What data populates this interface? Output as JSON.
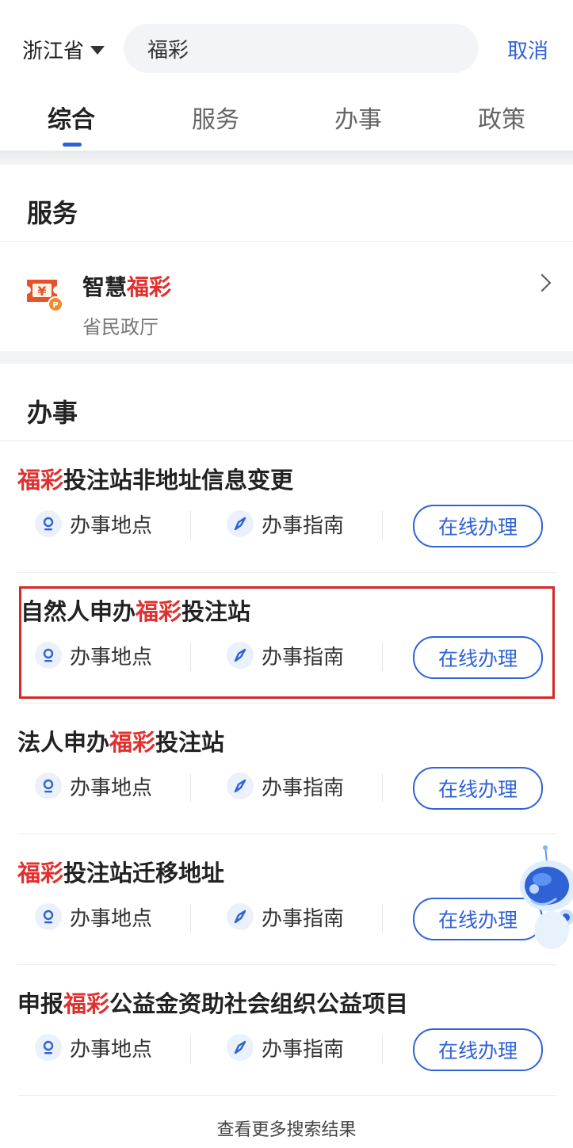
{
  "header": {
    "region": "浙江省",
    "search_value": "福彩",
    "cancel": "取消"
  },
  "tabs": [
    "综合",
    "服务",
    "办事",
    "政策"
  ],
  "service_section": {
    "title": "服务",
    "item": {
      "name_prefix": "智慧",
      "name_highlight": "福彩",
      "department": "省民政厅"
    }
  },
  "affairs_section": {
    "title": "办事",
    "items": [
      {
        "pre": "",
        "hl": "福彩",
        "post": "投注站非地址信息变更"
      },
      {
        "pre": "自然人申办",
        "hl": "福彩",
        "post": "投注站"
      },
      {
        "pre": "法人申办",
        "hl": "福彩",
        "post": "投注站"
      },
      {
        "pre": "",
        "hl": "福彩",
        "post": "投注站迁移地址"
      },
      {
        "pre": "申报",
        "hl": "福彩",
        "post": "公益金资助社会组织公益项目"
      }
    ],
    "actions": {
      "location": "办事地点",
      "guide": "办事指南",
      "online": "在线办理"
    }
  },
  "more_results": "查看更多搜索结果",
  "colors": {
    "accent": "#2f62d6",
    "highlight": "#e0302f",
    "annotation_box": "#d4282a"
  }
}
